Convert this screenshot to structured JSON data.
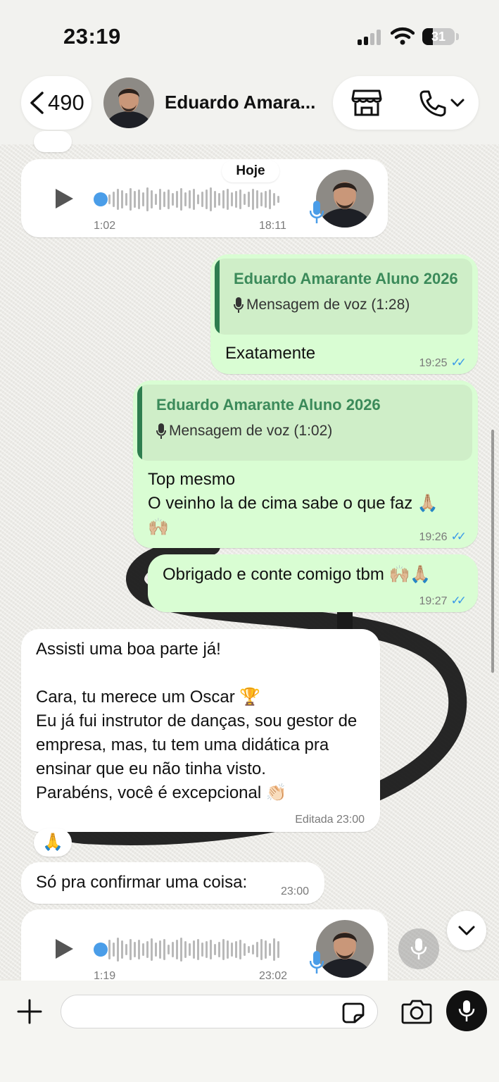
{
  "status": {
    "time": "23:19",
    "battery": "31"
  },
  "header": {
    "back_count": "490",
    "contact_name": "Eduardo Amara..."
  },
  "chat": {
    "date_chip": "Hoje",
    "voice1": {
      "duration": "1:02",
      "time": "18:11",
      "progress": 0.0
    },
    "msg1": {
      "quote_name": "Eduardo Amarante Aluno 2026",
      "quote_body": "Mensagem de voz (1:28)",
      "text": "Exatamente",
      "time": "19:25"
    },
    "msg2": {
      "quote_name": "Eduardo Amarante Aluno 2026",
      "quote_body": "Mensagem de voz (1:02)",
      "text": "Top mesmo\nO veinho la de cima sabe o que faz 🙏🏼\n🙌🏼",
      "time": "19:26"
    },
    "msg3": {
      "text": "Obrigado e conte comigo tbm 🙌🏼🙏🏼",
      "time": "19:27"
    },
    "msg4": {
      "text": "Assisti uma boa parte já!\n\nCara, tu merece um Oscar 🏆\nEu já fui instrutor de danças, sou gestor de empresa, mas, tu tem uma didática pra ensinar que eu não tinha visto.\nParabéns, você é excepcional 👏🏻",
      "time": "Editada 23:00",
      "reaction": "🙏"
    },
    "msg5": {
      "text": "Só pra confirmar uma coisa:",
      "time": "23:00"
    },
    "voice2": {
      "duration": "1:19",
      "time": "23:02",
      "progress": 0.0
    }
  },
  "input": {
    "placeholder": ""
  },
  "colors": {
    "outgoing": "#d9fdd3",
    "incoming": "#ffffff",
    "accent_green": "#3b8a5a",
    "read_ticks": "#3b9ae8"
  },
  "icons": [
    "chevron-left-icon",
    "store-icon",
    "phone-icon",
    "chevron-down-icon",
    "play-icon",
    "mic-icon",
    "plus-icon",
    "sticker-icon",
    "camera-icon"
  ]
}
